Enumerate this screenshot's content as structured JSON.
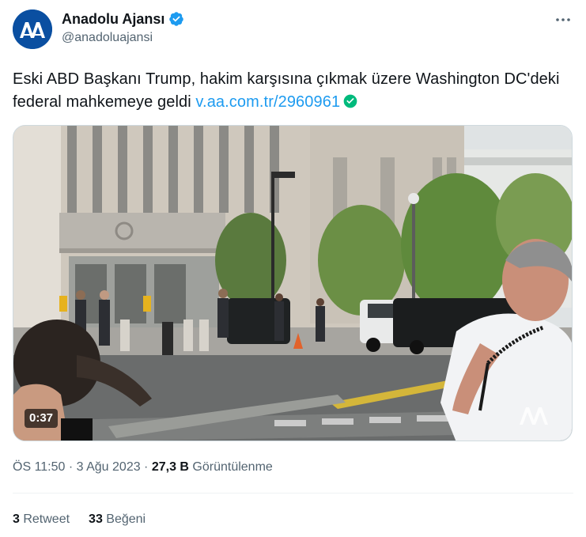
{
  "author": {
    "display_name": "Anadolu Ajansı",
    "handle": "@anadoluajansi",
    "avatar_text": "AA",
    "verified_icon": "verified-badge-icon"
  },
  "tweet": {
    "text_part1": "Eski ABD Başkanı Trump, hakim karşısına çıkmak üzere Washington DC'deki federal mahkemeye geldi ",
    "link": "v.aa.com.tr/2960961",
    "link_check_icon": "check-circle-icon"
  },
  "media": {
    "duration": "0:37",
    "watermark": "AA"
  },
  "meta": {
    "time": "ÖS 11:50",
    "sep1": " · ",
    "date": "3 Ağu 2023",
    "sep2": " · ",
    "views_count": "27,3 B",
    "views_label": " Görüntülenme"
  },
  "stats": {
    "retweets_count": "3",
    "retweets_label": " Retweet",
    "likes_count": "33",
    "likes_label": " Beğeni"
  },
  "colors": {
    "accent": "#1d9bf0",
    "verified": "#1d9bf0",
    "link_check": "#00ba7c",
    "avatar_bg": "#0a4fa1"
  }
}
